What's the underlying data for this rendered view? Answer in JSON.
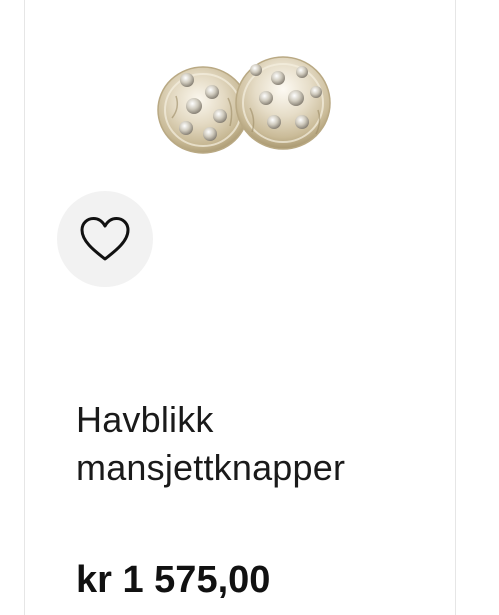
{
  "product": {
    "title_line1": "Havblikk",
    "title_line2": "mansjettknapper",
    "price": "kr 1 575,00",
    "image_icon": "cufflinks-image"
  },
  "favorite": {
    "icon": "heart-outline-icon"
  },
  "colors": {
    "text": "#1a1a1a",
    "favorite_bg": "#f2f2f2",
    "border": "#e6e6e6"
  }
}
